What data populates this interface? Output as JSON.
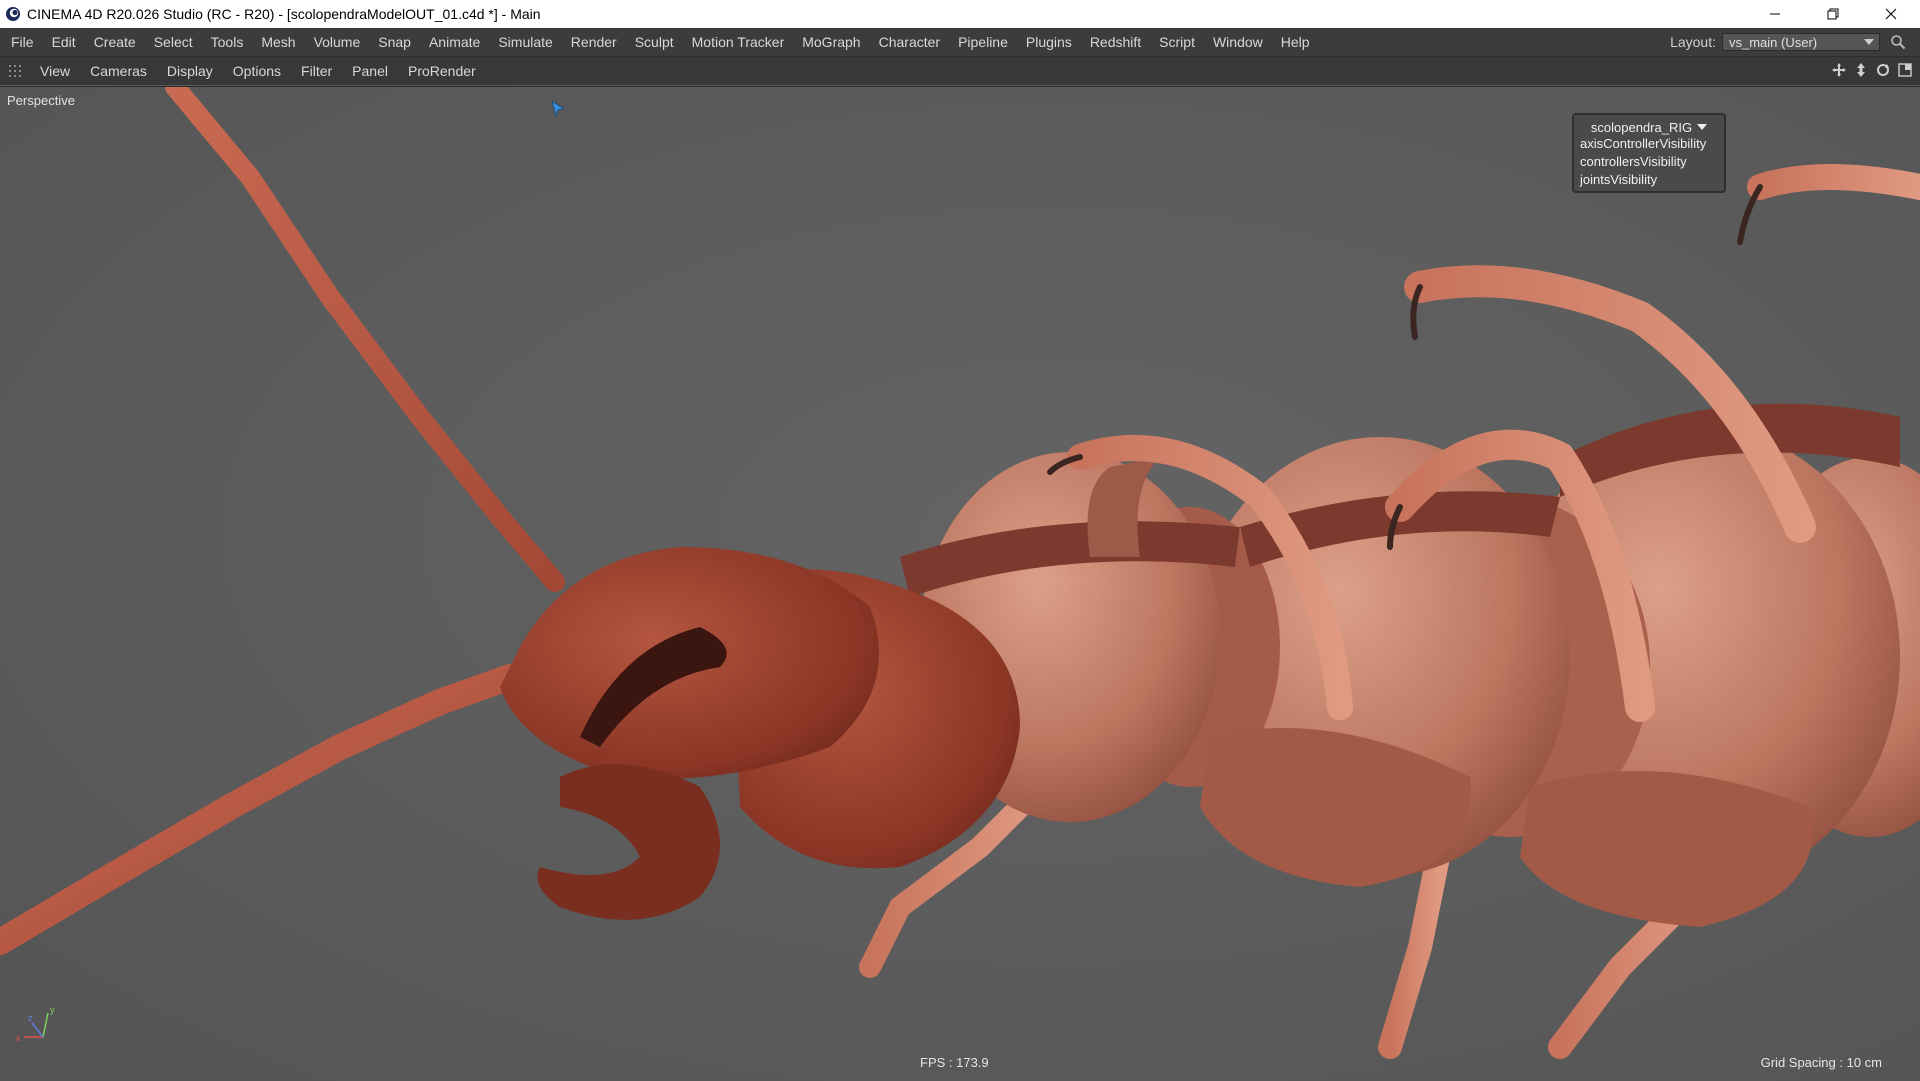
{
  "window": {
    "title": "CINEMA 4D R20.026 Studio (RC - R20) - [scolopendraModelOUT_01.c4d *] - Main"
  },
  "menubar": {
    "items": [
      "File",
      "Edit",
      "Create",
      "Select",
      "Tools",
      "Mesh",
      "Volume",
      "Snap",
      "Animate",
      "Simulate",
      "Render",
      "Sculpt",
      "Motion Tracker",
      "MoGraph",
      "Character",
      "Pipeline",
      "Plugins",
      "Redshift",
      "Script",
      "Window",
      "Help"
    ],
    "layout_label": "Layout:",
    "layout_value": "vs_main (User)"
  },
  "viewport_menu": {
    "items": [
      "View",
      "Cameras",
      "Display",
      "Options",
      "Filter",
      "Panel",
      "ProRender"
    ]
  },
  "viewport": {
    "camera_label": "Perspective",
    "fps": "FPS : 173.9",
    "grid_spacing": "Grid Spacing : 10 cm"
  },
  "rig_panel": {
    "title": "scolopendra_RIG",
    "items": [
      "axisControllerVisibility",
      "controllersVisibility",
      "jointsVisibility"
    ]
  },
  "colors": {
    "viewport_bg": "#5c5c5c",
    "menubar_bg": "#3c3c3c",
    "creature_body": "#b9735e",
    "creature_dark": "#7a3326",
    "accent_cursor": "#3d8fd9"
  },
  "icons": {
    "app": "cinema4d-logo-icon",
    "minimize": "minimize-icon",
    "restore": "restore-icon",
    "close": "close-icon",
    "search": "search-icon",
    "viewport_move": "move-view-icon",
    "viewport_down": "dolly-icon",
    "viewport_rotate": "rotate-view-icon",
    "viewport_maximize": "maximize-view-icon"
  }
}
